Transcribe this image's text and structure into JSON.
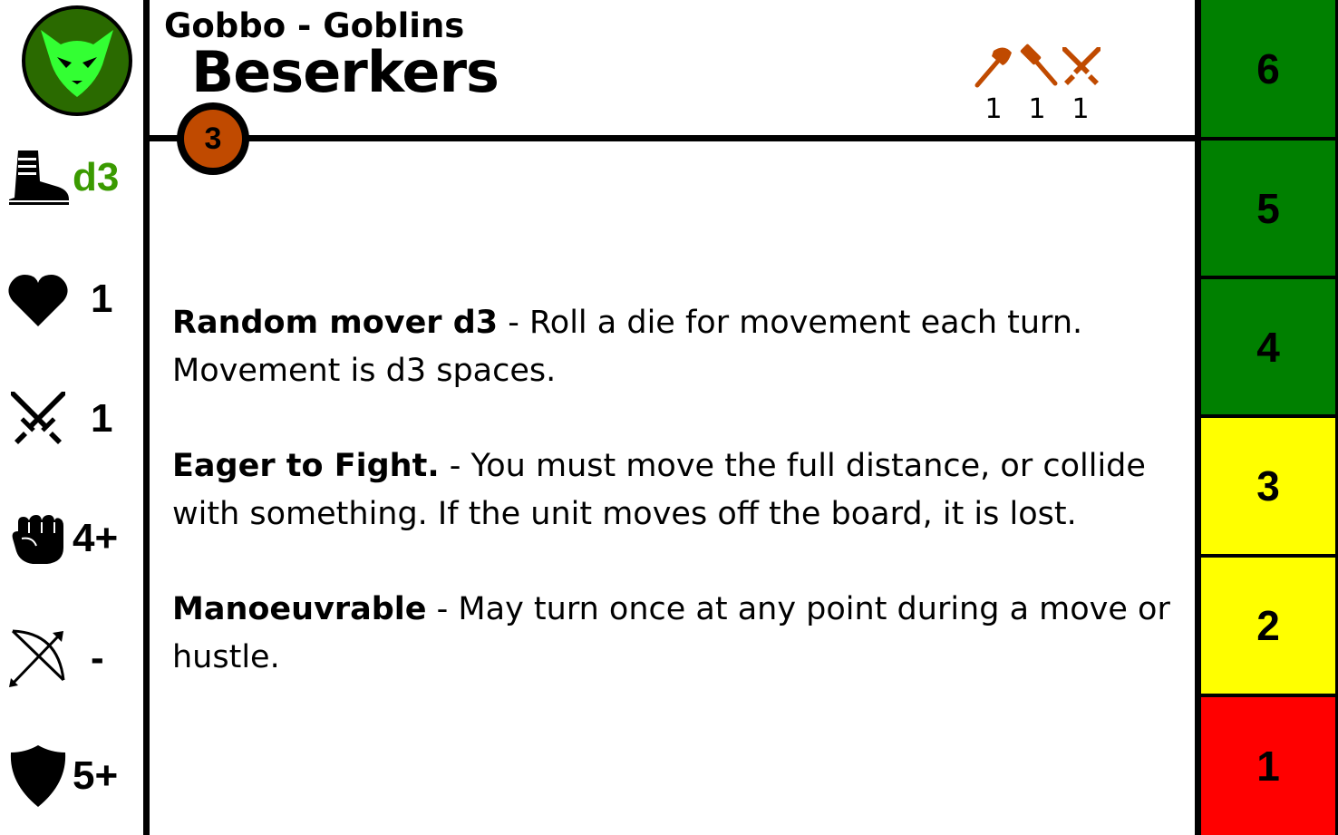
{
  "card": {
    "faction": "Gobbo - Goblins",
    "unit": "Beserkers",
    "cost": "3"
  },
  "colors": {
    "cost_badge": "#c04a00",
    "weapon_icons": "#c04a00",
    "move_value": "#3a9a00",
    "logo_bg": "#2a6a00",
    "logo_face": "#33ff33",
    "track_green": "#008000",
    "track_yellow": "#ffff00",
    "track_red": "#ff0000"
  },
  "stats": [
    {
      "icon": "boot-icon",
      "value": "d3"
    },
    {
      "icon": "heart-icon",
      "value": "1"
    },
    {
      "icon": "crossed-swords-icon",
      "value": "1"
    },
    {
      "icon": "fist-icon",
      "value": "4+"
    },
    {
      "icon": "bow-icon",
      "value": "-"
    },
    {
      "icon": "shield-icon",
      "value": "5+"
    }
  ],
  "weapons": [
    {
      "icon": "axe-icon",
      "count": "1"
    },
    {
      "icon": "hammer-icon",
      "count": "1"
    },
    {
      "icon": "crossed-swords-icon",
      "count": "1"
    }
  ],
  "rules": [
    {
      "name": "Random mover d3",
      "text": " - Roll a die for movement each turn. Movement is d3 spaces."
    },
    {
      "name": "Eager to Fight.",
      "text": " - You must move the full distance, or collide with something. If the unit moves off the board, it is lost."
    },
    {
      "name": "Manoeuvrable",
      "text": " - May turn once at any point during a move or hustle."
    }
  ],
  "track": [
    {
      "value": "6",
      "color": "green"
    },
    {
      "value": "5",
      "color": "green"
    },
    {
      "value": "4",
      "color": "green"
    },
    {
      "value": "3",
      "color": "yellow"
    },
    {
      "value": "2",
      "color": "yellow"
    },
    {
      "value": "1",
      "color": "red"
    }
  ]
}
